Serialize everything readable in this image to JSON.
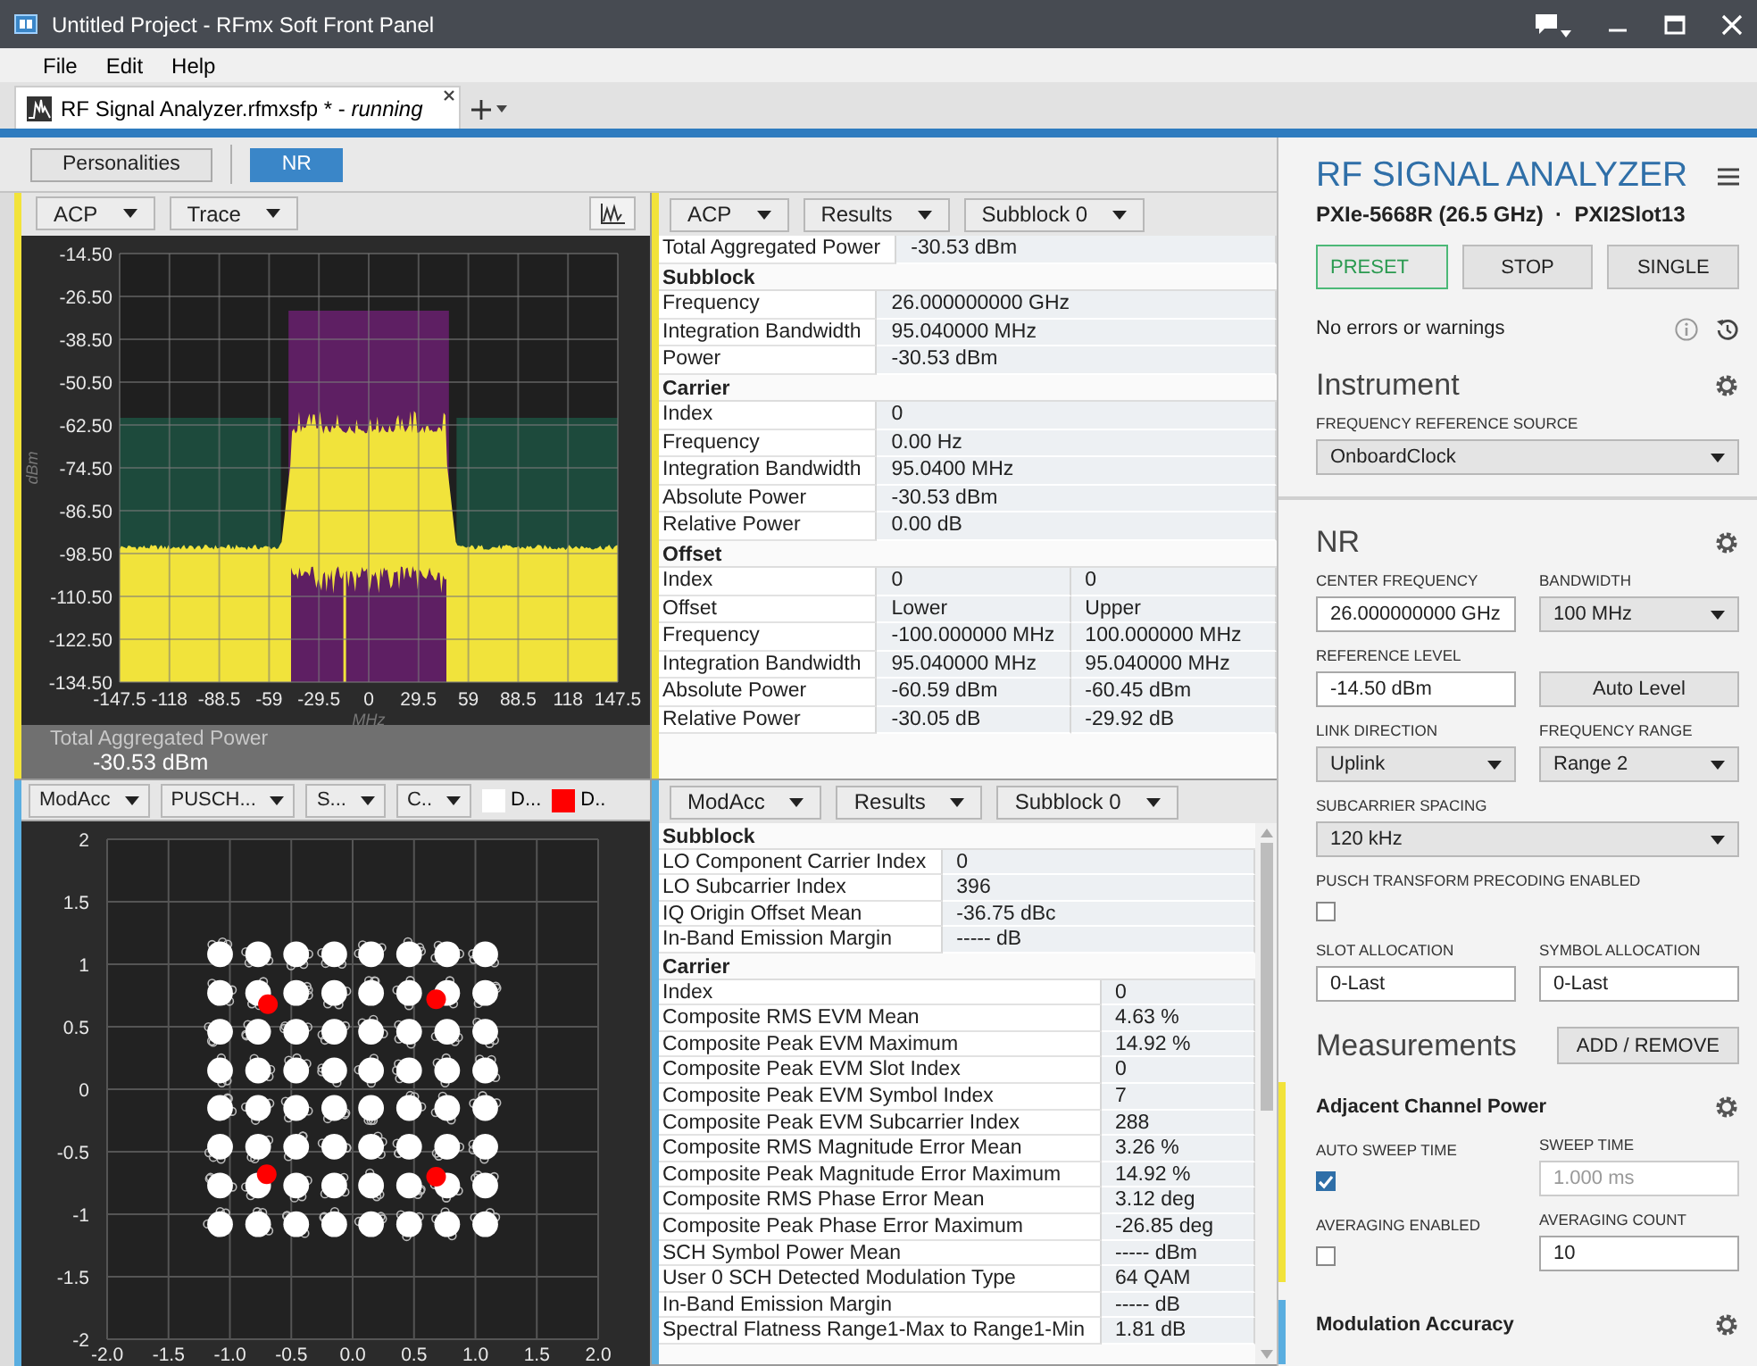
{
  "window": {
    "title": "Untitled Project - RFmx Soft Front Panel"
  },
  "menu": [
    "File",
    "Edit",
    "Help"
  ],
  "document_tabs": [
    {
      "label": "RF Signal Analyzer.rfmxsfp * - *running*",
      "selected": true
    }
  ],
  "toolbar": {
    "buttons": [
      {
        "label": "Personalities",
        "selected": false
      },
      {
        "label": "NR",
        "selected": true
      }
    ]
  },
  "spectrum_pane": {
    "color": "#f2e33a",
    "dropdowns": [
      "ACP",
      "Trace"
    ],
    "y_ticks": [
      "-14.50",
      "-26.50",
      "-38.50",
      "-50.50",
      "-62.50",
      "-74.50",
      "-86.50",
      "-98.50",
      "-110.50",
      "-122.50",
      "-134.50"
    ],
    "x_ticks": [
      "-147.5",
      "-118",
      "-88.5",
      "-59",
      "-29.5",
      "0",
      "29.5",
      "59",
      "88.5",
      "118",
      "147.5"
    ],
    "y_label": "dBm",
    "x_label": "MHz",
    "summary_label": "Total Aggregated Power",
    "summary_value": "-30.53 dBm"
  },
  "acp_results": {
    "color": "#f2e33a",
    "dropdowns": [
      "ACP",
      "Results",
      "Subblock 0"
    ],
    "sections": [
      {
        "rows": [
          {
            "label": "Total Aggregated Power",
            "values": [
              "-30.53 dBm"
            ]
          }
        ]
      },
      {
        "title": "Subblock",
        "rows": [
          {
            "label": "Frequency",
            "values": [
              "26.000000000 GHz"
            ]
          },
          {
            "label": "Integration Bandwidth",
            "values": [
              "95.040000 MHz"
            ]
          },
          {
            "label": "Power",
            "values": [
              "-30.53 dBm"
            ]
          }
        ]
      },
      {
        "title": "Carrier",
        "rows": [
          {
            "label": "Index",
            "values": [
              "0"
            ]
          },
          {
            "label": "Frequency",
            "values": [
              "0.00 Hz"
            ]
          },
          {
            "label": "Integration Bandwidth",
            "values": [
              "95.0400 MHz"
            ]
          },
          {
            "label": "Absolute Power",
            "values": [
              "-30.53 dBm"
            ]
          },
          {
            "label": "Relative Power",
            "values": [
              "0.00 dB"
            ]
          }
        ]
      },
      {
        "title": "Offset",
        "rows": [
          {
            "label": "Index",
            "values": [
              "0",
              "0"
            ]
          },
          {
            "label": "Offset",
            "values": [
              "Lower",
              "Upper"
            ]
          },
          {
            "label": "Frequency",
            "values": [
              "-100.000000 MHz",
              "100.000000 MHz"
            ]
          },
          {
            "label": "Integration Bandwidth",
            "values": [
              "95.040000 MHz",
              "95.040000 MHz"
            ]
          },
          {
            "label": "Absolute Power",
            "values": [
              "-60.59 dBm",
              "-60.45 dBm"
            ]
          },
          {
            "label": "Relative Power",
            "values": [
              "-30.05 dB",
              "-29.92 dB"
            ]
          }
        ]
      }
    ]
  },
  "constellation_pane": {
    "color": "#5aaee0",
    "dropdowns": [
      "ModAcc",
      "PUSCH...",
      "S...",
      "C.."
    ],
    "legend": [
      {
        "label": "D...",
        "color": "#ffffff"
      },
      {
        "label": "D..",
        "color": "#ff0000"
      }
    ],
    "y_ticks": [
      "2",
      "1.5",
      "1",
      "0.5",
      "0",
      "-0.5",
      "-1",
      "-1.5",
      "-2"
    ],
    "x_ticks": [
      "-2.0",
      "-1.5",
      "-1.0",
      "-0.5",
      "0.0",
      "0.5",
      "1.0",
      "1.5",
      "2.0"
    ]
  },
  "modacc_results": {
    "color": "#5aaee0",
    "dropdowns": [
      "ModAcc",
      "Results",
      "Subblock 0"
    ],
    "sections": [
      {
        "title": "Subblock",
        "rows": [
          {
            "label": "LO Component Carrier Index",
            "values": [
              "0"
            ]
          },
          {
            "label": "LO Subcarrier Index",
            "values": [
              "396"
            ]
          },
          {
            "label": "IQ Origin Offset Mean",
            "values": [
              "-36.75 dBc"
            ]
          },
          {
            "label": "In-Band Emission Margin",
            "values": [
              "----- dB"
            ]
          }
        ]
      },
      {
        "title": "Carrier",
        "rows": [
          {
            "label": "Index",
            "values": [
              "0"
            ]
          },
          {
            "label": "Composite RMS EVM Mean",
            "values": [
              "4.63 %"
            ]
          },
          {
            "label": "Composite Peak EVM Maximum",
            "values": [
              "14.92 %"
            ]
          },
          {
            "label": "Composite Peak EVM Slot Index",
            "values": [
              "0"
            ]
          },
          {
            "label": "Composite Peak EVM Symbol Index",
            "values": [
              "7"
            ]
          },
          {
            "label": "Composite Peak EVM Subcarrier Index",
            "values": [
              "288"
            ]
          },
          {
            "label": "Composite RMS Magnitude Error Mean",
            "values": [
              "3.26 %"
            ]
          },
          {
            "label": "Composite Peak Magnitude Error Maximum",
            "values": [
              "14.92 %"
            ]
          },
          {
            "label": "Composite RMS Phase Error Mean",
            "values": [
              "3.12 deg"
            ]
          },
          {
            "label": "Composite Peak Phase Error Maximum",
            "values": [
              "-26.85 deg"
            ]
          },
          {
            "label": "SCH Symbol Power Mean",
            "values": [
              "----- dBm"
            ]
          },
          {
            "label": "User 0 SCH Detected Modulation Type",
            "values": [
              "64 QAM"
            ]
          },
          {
            "label": "In-Band Emission Margin",
            "values": [
              "----- dB"
            ]
          },
          {
            "label": "Spectral Flatness Range1-Max to Range1-Min",
            "values": [
              "1.81 dB"
            ]
          }
        ]
      }
    ]
  },
  "settings": {
    "title": "RF SIGNAL ANALYZER",
    "subtitle": "PXIe-5668R (26.5 GHz)  ·  PXI2Slot13",
    "actions": [
      {
        "label": "PRESET",
        "selected": true
      },
      {
        "label": "STOP",
        "selected": false
      },
      {
        "label": "SINGLE",
        "selected": false
      }
    ],
    "status": "No errors or warnings",
    "sections": [
      {
        "title": "Instrument",
        "rows": [
          [
            {
              "kind": "select",
              "label": "FREQUENCY REFERENCE SOURCE",
              "value": "OnboardClock"
            }
          ]
        ]
      },
      {
        "title": "NR",
        "rows": [
          [
            {
              "kind": "text",
              "label": "CENTER FREQUENCY",
              "value": "26.000000000 GHz",
              "disabled": false
            },
            {
              "kind": "select",
              "label": "BANDWIDTH",
              "value": "100 MHz"
            }
          ],
          [
            {
              "kind": "text",
              "label": "REFERENCE LEVEL",
              "value": "-14.50 dBm",
              "disabled": false
            },
            {
              "kind": "button",
              "value": "Auto Level"
            }
          ],
          [
            {
              "kind": "select",
              "label": "LINK DIRECTION",
              "value": "Uplink"
            },
            {
              "kind": "select",
              "label": "FREQUENCY RANGE",
              "value": "Range 2"
            }
          ],
          [
            {
              "kind": "select",
              "label": "SUBCARRIER SPACING",
              "value": "120 kHz"
            }
          ],
          [
            {
              "kind": "checkbox",
              "label": "PUSCH TRANSFORM PRECODING ENABLED",
              "checked": false
            }
          ],
          [
            {
              "kind": "text",
              "label": "SLOT ALLOCATION",
              "value": "0-Last",
              "disabled": false
            },
            {
              "kind": "text",
              "label": "SYMBOL ALLOCATION",
              "value": "0-Last",
              "disabled": false
            }
          ]
        ]
      }
    ],
    "measurements": {
      "title": "Measurements",
      "button": "ADD / REMOVE",
      "items": [
        {
          "name": "Adjacent Channel Power",
          "color": "#f2e33a",
          "rows": [
            [
              {
                "kind": "checkbox",
                "label": "AUTO SWEEP TIME",
                "checked": true
              },
              {
                "kind": "text",
                "label": "SWEEP TIME",
                "value": "1.000 ms",
                "disabled": true
              }
            ],
            [
              {
                "kind": "checkbox",
                "label": "AVERAGING ENABLED",
                "checked": false
              },
              {
                "kind": "text",
                "label": "AVERAGING COUNT",
                "value": "10",
                "disabled": false
              }
            ]
          ]
        },
        {
          "name": "Modulation Accuracy",
          "color": "#5aaee0"
        }
      ]
    }
  }
}
